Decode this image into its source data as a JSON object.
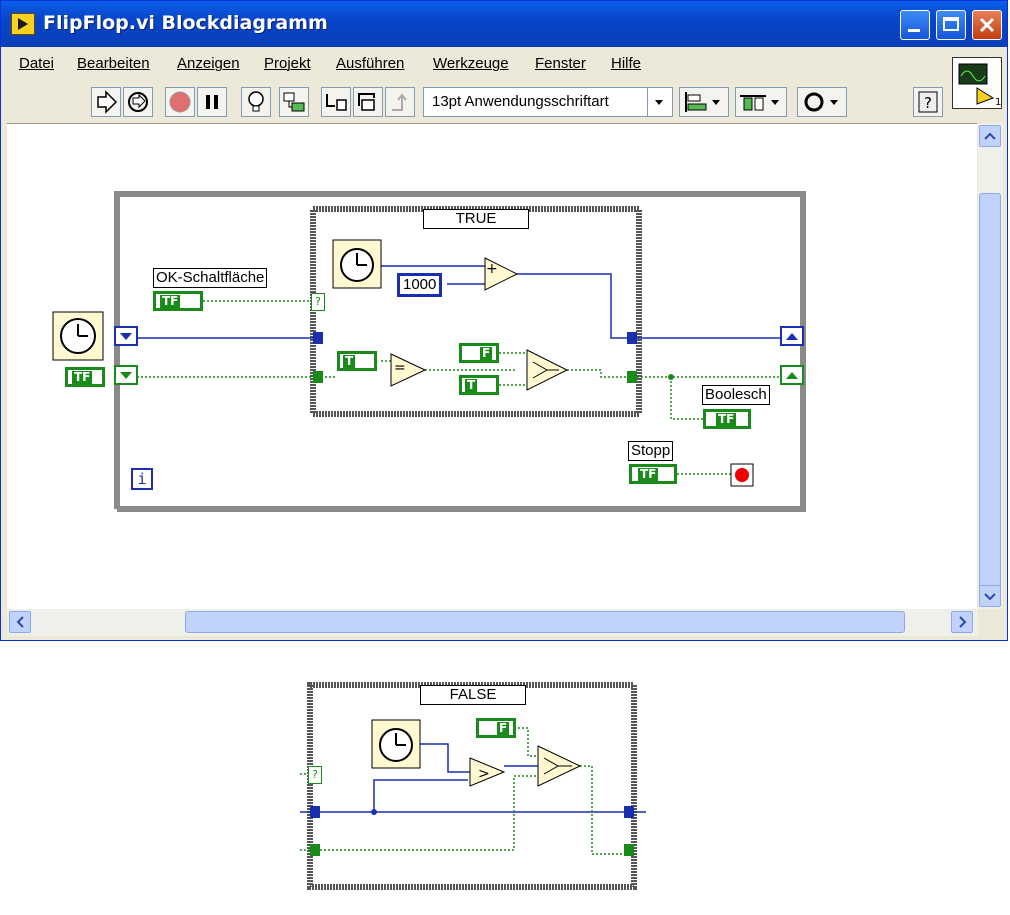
{
  "window": {
    "title": "FlipFlop.vi Blockdiagramm"
  },
  "menu": [
    "Datei",
    "Bearbeiten",
    "Anzeigen",
    "Projekt",
    "Ausführen",
    "Werkzeuge",
    "Fenster",
    "Hilfe"
  ],
  "toolbar": {
    "run_icon": "run-arrow-icon",
    "run_continuous_icon": "run-continuously-icon",
    "abort_icon": "abort-icon",
    "pause_icon": "pause-icon",
    "highlight_icon": "lightbulb-icon",
    "retain_values_icon": "retain-wire-values-icon",
    "step_into_icon": "step-into-icon",
    "step_over_icon": "step-over-icon",
    "step_out_icon": "step-out-icon",
    "font": "13pt Anwendungsschriftart",
    "align_icon": "align-objects-icon",
    "distribute_icon": "distribute-objects-icon",
    "reorder_icon": "reorder-icon",
    "help_icon": "context-help-icon"
  },
  "vi_icon": {
    "number": "1"
  },
  "diagram": {
    "control_ok": "OK-Schaltfläche",
    "case_true": "TRUE",
    "constant_1000": "1000",
    "indicator_bool": "Boolesch",
    "control_stop": "Stopp",
    "loop_iteration": "i",
    "unknown_terminal": "?",
    "bool_true": "T",
    "bool_false": "F",
    "bool_tf": "TF",
    "op_add": "+",
    "op_equal": "=",
    "op_greater": ">"
  },
  "false_case": {
    "case_false": "FALSE",
    "unknown_terminal": "?"
  },
  "colors": {
    "title_bar": "#0845c9",
    "wire_numeric": "#1a2faf",
    "wire_bool": "#1a8a1a",
    "node_fill": "#fff8d0",
    "frame_gray": "#888888"
  }
}
